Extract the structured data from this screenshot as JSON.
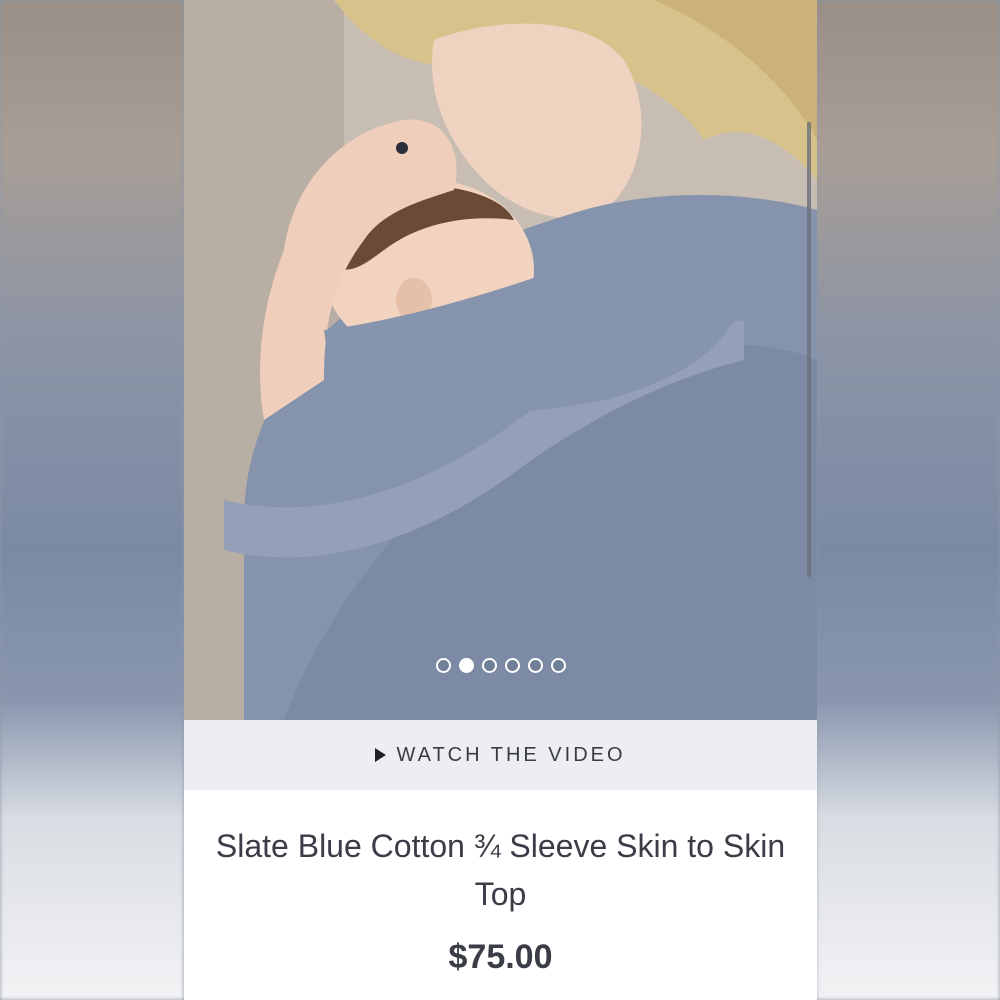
{
  "gallery": {
    "image_alt": "Mother holding sleeping baby in slate blue skin to skin top",
    "dot_count": 6,
    "active_index": 1
  },
  "video": {
    "label": "WATCH THE VIDEO",
    "icon": "play-icon"
  },
  "product": {
    "title": "Slate Blue Cotton ¾ Sleeve Skin to Skin Top",
    "price": "$75.00"
  },
  "colors": {
    "top_color": "#8593ad",
    "text": "#3a3c46",
    "video_bar_bg": "#eceef1"
  }
}
